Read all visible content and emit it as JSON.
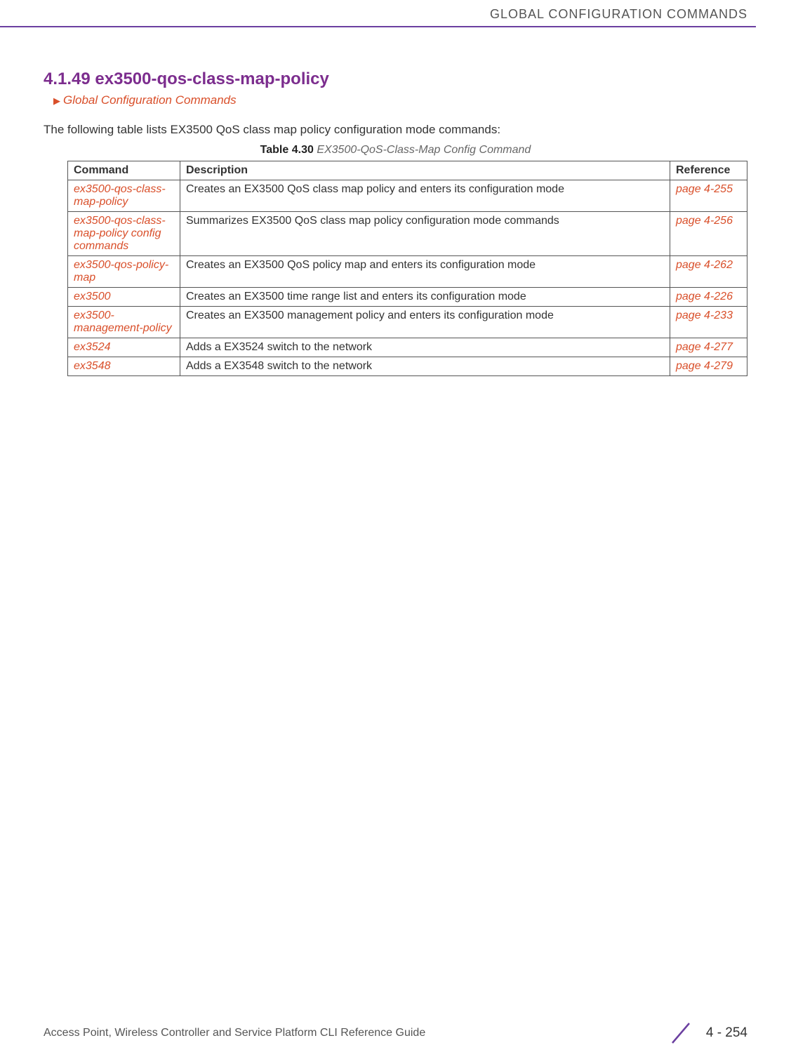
{
  "header": {
    "title": "GLOBAL CONFIGURATION COMMANDS"
  },
  "section": {
    "heading": "4.1.49 ex3500-qos-class-map-policy",
    "breadcrumb": "Global Configuration Commands",
    "intro": "The following table lists EX3500 QoS class map policy configuration mode commands:"
  },
  "table": {
    "caption_label": "Table 4.30",
    "caption_title": "EX3500-QoS-Class-Map Config Command",
    "headers": {
      "command": "Command",
      "description": "Description",
      "reference": "Reference"
    },
    "rows": [
      {
        "command": "ex3500-qos-class-map-policy",
        "description": "Creates an EX3500 QoS class map policy and enters its configuration mode",
        "reference": "page 4-255"
      },
      {
        "command": "ex3500-qos-class-map-policy config commands",
        "description": "Summarizes EX3500 QoS class map policy configuration mode commands",
        "reference": "page 4-256"
      },
      {
        "command": "ex3500-qos-policy-map",
        "description": "Creates an EX3500 QoS policy map and enters its configuration mode",
        "reference": "page 4-262"
      },
      {
        "command": "ex3500",
        "description": "Creates an EX3500 time range list and enters its configuration mode",
        "reference": "page 4-226"
      },
      {
        "command": "ex3500-management-policy",
        "description": "Creates an EX3500 management policy and enters its configuration mode",
        "reference": "page 4-233"
      },
      {
        "command": "ex3524",
        "description": "Adds a EX3524 switch to the network",
        "reference": "page 4-277"
      },
      {
        "command": "ex3548",
        "description": "Adds a EX3548 switch to the network",
        "reference": "page 4-279"
      }
    ]
  },
  "footer": {
    "left": "Access Point, Wireless Controller and Service Platform CLI Reference Guide",
    "page": "4 - 254"
  }
}
